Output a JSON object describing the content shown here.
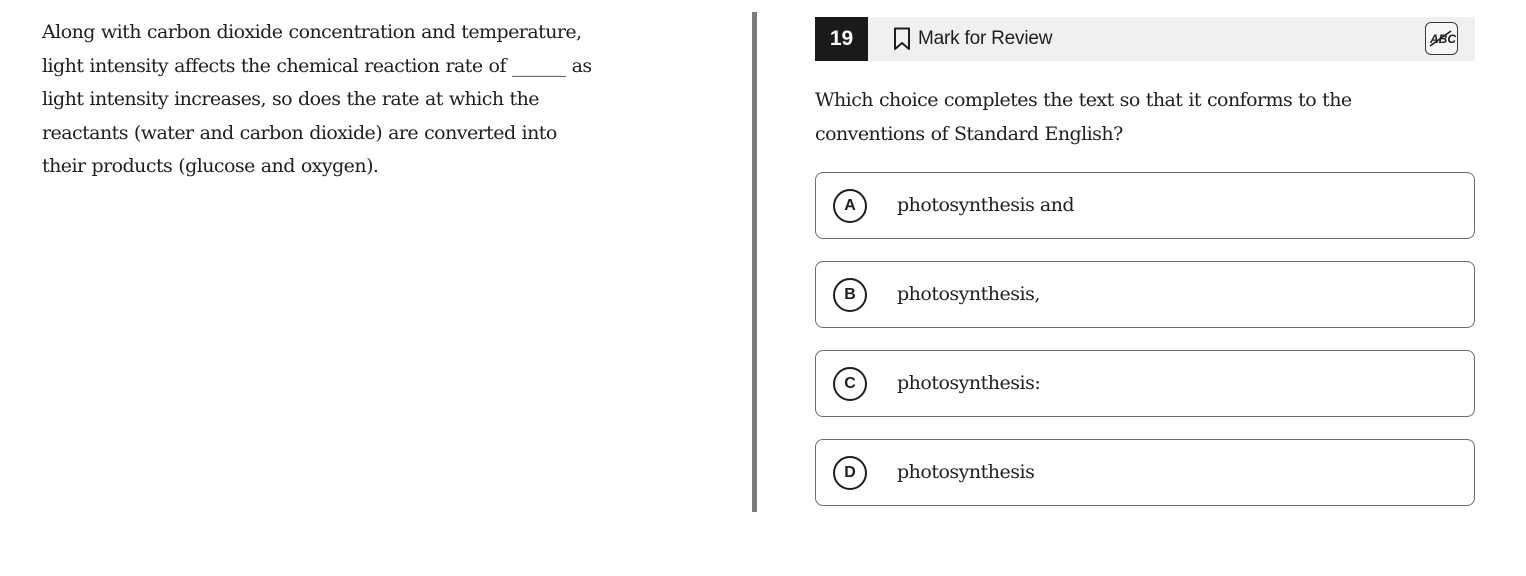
{
  "passage": {
    "lines": [
      "Along with carbon dioxide concentration and temperature,",
      "light intensity affects the chemical reaction rate of ______ as",
      "light intensity increases, so does the rate at which the",
      "reactants (water and carbon dioxide) are converted into",
      "their products (glucose and oxygen)."
    ]
  },
  "question": {
    "number": "19",
    "mark_for_review_label": "Mark for Review",
    "abc_tool_icon": "abc-strikethrough-icon",
    "bookmark_icon": "bookmark-icon",
    "prompt_lines": [
      "Which choice completes the text so that it conforms to the",
      "conventions of Standard English?"
    ]
  },
  "choices": [
    {
      "letter": "A",
      "text": "photosynthesis and"
    },
    {
      "letter": "B",
      "text": "photosynthesis,"
    },
    {
      "letter": "C",
      "text": "photosynthesis:"
    },
    {
      "letter": "D",
      "text": "photosynthesis"
    }
  ],
  "colors": {
    "question_number_bg": "#1a1a1a",
    "header_bar_bg": "#f0f0f0",
    "divider": "#7b7b7b",
    "choice_border": "#6e6e6e",
    "text": "#1e1e1e"
  }
}
